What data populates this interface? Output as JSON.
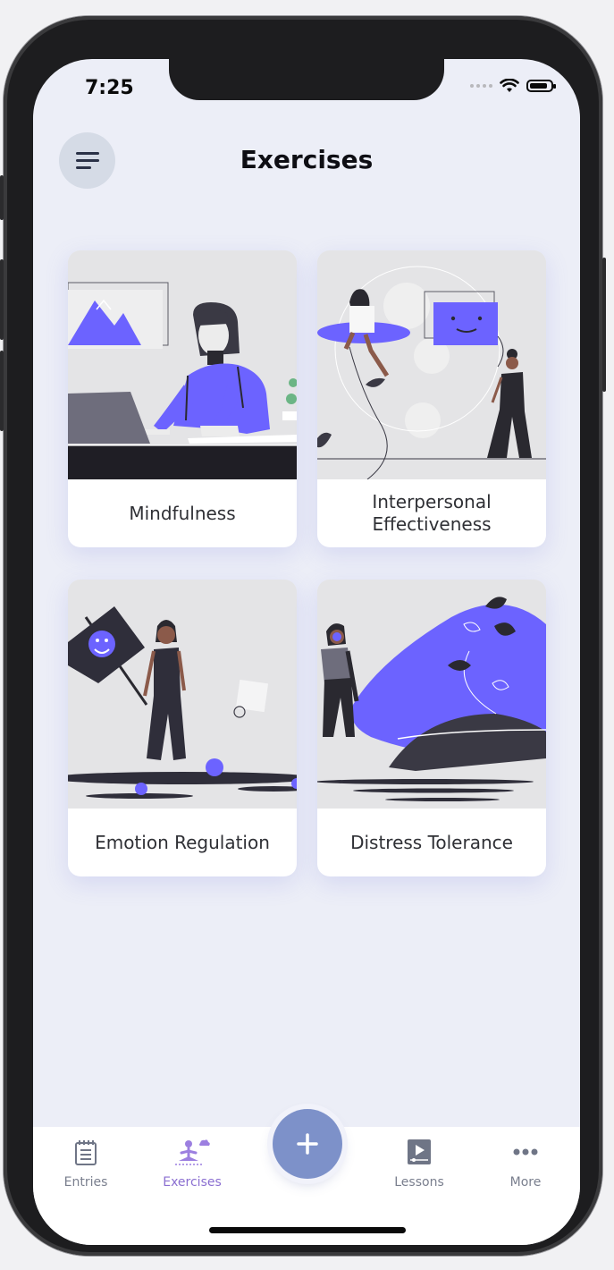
{
  "status_bar": {
    "time": "7:25"
  },
  "header": {
    "title": "Exercises",
    "menu_icon": "menu-icon"
  },
  "cards": [
    {
      "label": "Mindfulness",
      "illustration": "woman-at-laptop-illustration"
    },
    {
      "label": "Interpersonal Effectiveness",
      "illustration": "people-with-screen-illustration"
    },
    {
      "label": "Emotion Regulation",
      "illustration": "woman-with-sign-illustration"
    },
    {
      "label": "Distress Tolerance",
      "illustration": "woman-with-headphones-illustration"
    }
  ],
  "tabbar": {
    "tabs": [
      {
        "label": "Entries",
        "icon": "notebook-icon"
      },
      {
        "label": "Exercises",
        "icon": "meditation-icon",
        "active": true
      },
      {
        "label": "Lessons",
        "icon": "video-icon"
      },
      {
        "label": "More",
        "icon": "ellipsis-icon"
      }
    ],
    "fab_icon": "plus-icon"
  },
  "colors": {
    "accent": "#6c63ff",
    "active_tab": "#8b6fd1",
    "fab": "#7d91c9",
    "background": "#eceef7"
  }
}
